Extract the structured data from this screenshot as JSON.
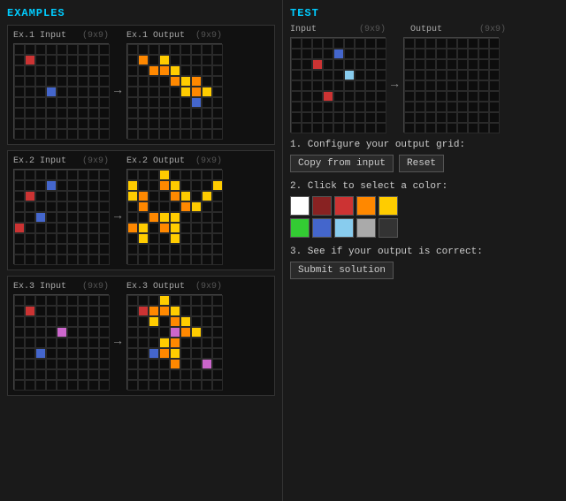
{
  "left": {
    "title": "EXAMPLES",
    "examples": [
      {
        "id": 1,
        "input_label": "Ex.1 Input",
        "output_label": "Ex.1 Output",
        "size": "(9x9)",
        "input_cells": [
          {
            "r": 1,
            "c": 1,
            "color": "#cc3333"
          },
          {
            "r": 4,
            "c": 3,
            "color": "#4466cc"
          }
        ],
        "output_cells": [
          {
            "r": 1,
            "c": 3,
            "color": "#ffcc00"
          },
          {
            "r": 2,
            "c": 3,
            "color": "#ff8800"
          },
          {
            "r": 2,
            "c": 4,
            "color": "#ffcc00"
          },
          {
            "r": 3,
            "c": 4,
            "color": "#ff8800"
          },
          {
            "r": 3,
            "c": 5,
            "color": "#ffcc00"
          },
          {
            "r": 3,
            "c": 6,
            "color": "#ff8800"
          },
          {
            "r": 2,
            "c": 2,
            "color": "#ff8800"
          },
          {
            "r": 1,
            "c": 1,
            "color": "#ff8800"
          },
          {
            "r": 4,
            "c": 5,
            "color": "#ffcc00"
          },
          {
            "r": 4,
            "c": 6,
            "color": "#ff8800"
          },
          {
            "r": 5,
            "c": 6,
            "color": "#4466cc"
          },
          {
            "r": 4,
            "c": 7,
            "color": "#ffcc00"
          }
        ]
      },
      {
        "id": 2,
        "input_label": "Ex.2 Input",
        "output_label": "Ex.2 Output",
        "size": "(9x9)",
        "input_cells": [
          {
            "r": 1,
            "c": 3,
            "color": "#4466cc"
          },
          {
            "r": 2,
            "c": 1,
            "color": "#cc3333"
          },
          {
            "r": 4,
            "c": 2,
            "color": "#4466cc"
          },
          {
            "r": 5,
            "c": 0,
            "color": "#cc3333"
          }
        ],
        "output_cells": [
          {
            "r": 0,
            "c": 3,
            "color": "#ffcc00"
          },
          {
            "r": 1,
            "c": 3,
            "color": "#ff8800"
          },
          {
            "r": 1,
            "c": 4,
            "color": "#ffcc00"
          },
          {
            "r": 2,
            "c": 4,
            "color": "#ff8800"
          },
          {
            "r": 2,
            "c": 5,
            "color": "#ffcc00"
          },
          {
            "r": 3,
            "c": 5,
            "color": "#ff8800"
          },
          {
            "r": 3,
            "c": 1,
            "color": "#ff8800"
          },
          {
            "r": 2,
            "c": 1,
            "color": "#ff8800"
          },
          {
            "r": 2,
            "c": 0,
            "color": "#ffcc00"
          },
          {
            "r": 1,
            "c": 0,
            "color": "#ffcc00"
          },
          {
            "r": 4,
            "c": 2,
            "color": "#ff8800"
          },
          {
            "r": 4,
            "c": 3,
            "color": "#ffcc00"
          },
          {
            "r": 5,
            "c": 3,
            "color": "#ff8800"
          },
          {
            "r": 5,
            "c": 0,
            "color": "#ff8800"
          },
          {
            "r": 5,
            "c": 1,
            "color": "#ffcc00"
          },
          {
            "r": 6,
            "c": 1,
            "color": "#ffcc00"
          },
          {
            "r": 5,
            "c": 4,
            "color": "#ffcc00"
          },
          {
            "r": 4,
            "c": 4,
            "color": "#ffcc00"
          },
          {
            "r": 6,
            "c": 4,
            "color": "#ffcc00"
          },
          {
            "r": 3,
            "c": 6,
            "color": "#ffcc00"
          },
          {
            "r": 2,
            "c": 7,
            "color": "#ffcc00"
          },
          {
            "r": 1,
            "c": 8,
            "color": "#ffcc00"
          }
        ]
      },
      {
        "id": 3,
        "input_label": "Ex.3 Input",
        "output_label": "Ex.3 Output",
        "size": "(9x9)",
        "input_cells": [
          {
            "r": 1,
            "c": 1,
            "color": "#cc3333"
          },
          {
            "r": 3,
            "c": 4,
            "color": "#cc66cc"
          },
          {
            "r": 5,
            "c": 2,
            "color": "#4466cc"
          }
        ],
        "output_cells": [
          {
            "r": 0,
            "c": 3,
            "color": "#ffcc00"
          },
          {
            "r": 1,
            "c": 3,
            "color": "#ff8800"
          },
          {
            "r": 1,
            "c": 4,
            "color": "#ffcc00"
          },
          {
            "r": 2,
            "c": 4,
            "color": "#ff8800"
          },
          {
            "r": 2,
            "c": 5,
            "color": "#ffcc00"
          },
          {
            "r": 3,
            "c": 5,
            "color": "#ff8800"
          },
          {
            "r": 3,
            "c": 6,
            "color": "#ffcc00"
          },
          {
            "r": 3,
            "c": 4,
            "color": "#cc66cc"
          },
          {
            "r": 4,
            "c": 4,
            "color": "#ff8800"
          },
          {
            "r": 4,
            "c": 3,
            "color": "#ffcc00"
          },
          {
            "r": 5,
            "c": 3,
            "color": "#ff8800"
          },
          {
            "r": 5,
            "c": 2,
            "color": "#4466cc"
          },
          {
            "r": 5,
            "c": 4,
            "color": "#ffcc00"
          },
          {
            "r": 6,
            "c": 4,
            "color": "#ff8800"
          },
          {
            "r": 1,
            "c": 1,
            "color": "#cc3333"
          },
          {
            "r": 1,
            "c": 2,
            "color": "#ff8800"
          },
          {
            "r": 2,
            "c": 2,
            "color": "#ffcc00"
          },
          {
            "r": 6,
            "c": 7,
            "color": "#cc66cc"
          }
        ]
      }
    ]
  },
  "right": {
    "title": "TEST",
    "input_label": "Input",
    "output_label": "Output",
    "size": "(9x9)",
    "input_cells": [
      {
        "r": 1,
        "c": 4,
        "color": "#4466cc"
      },
      {
        "r": 2,
        "c": 2,
        "color": "#cc3333"
      },
      {
        "r": 3,
        "c": 5,
        "color": "#88ccee"
      },
      {
        "r": 5,
        "c": 3,
        "color": "#cc3333"
      }
    ],
    "step1": "1. Configure your output grid:",
    "copy_btn": "Copy from input",
    "reset_btn": "Reset",
    "step2": "2. Click to select a color:",
    "colors_row1": [
      "#ffffff",
      "#882222",
      "#cc3333",
      "#ff8800",
      "#ffcc00"
    ],
    "colors_row2": [
      "#33cc33",
      "#4466cc",
      "#88ccee",
      "#aaaaaa",
      "#333333"
    ],
    "step3": "3. See if your output is correct:",
    "submit_btn": "Submit solution"
  }
}
